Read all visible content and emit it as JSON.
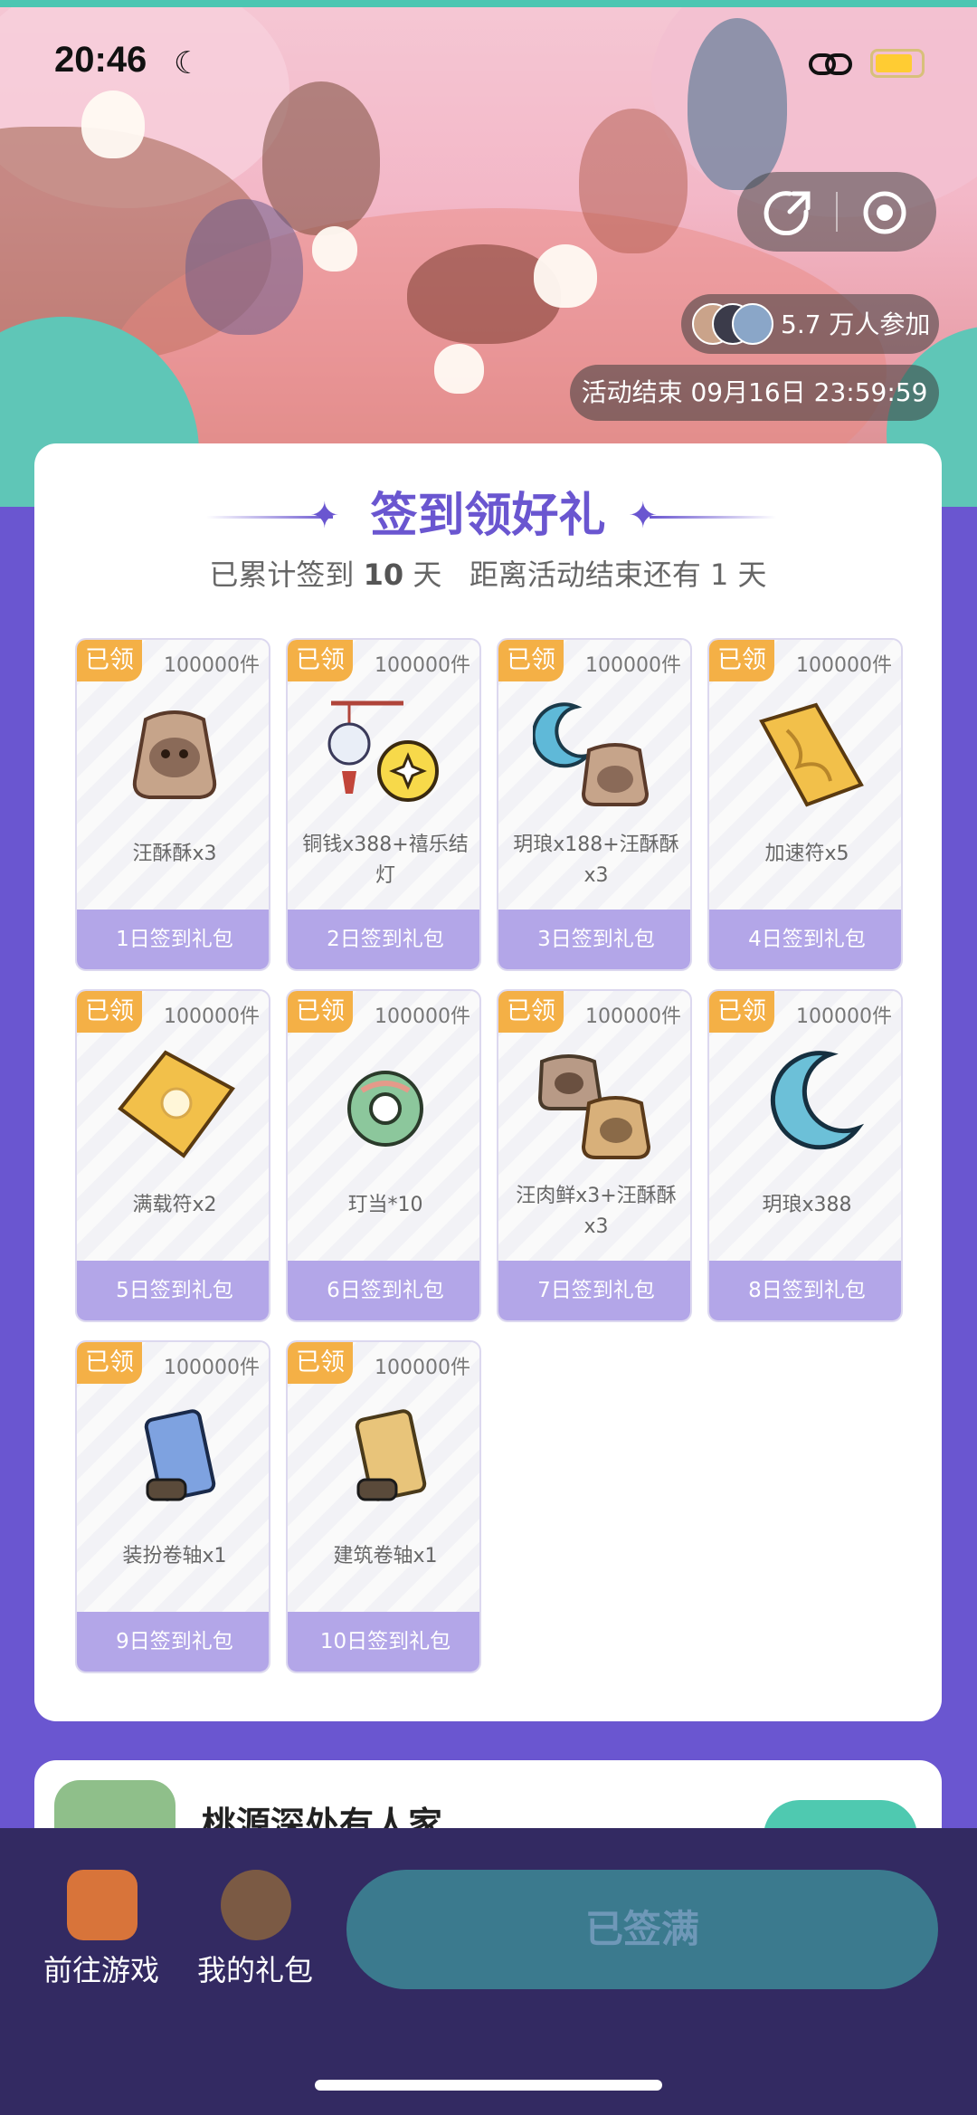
{
  "status_bar": {
    "time": "20:46"
  },
  "banner": {
    "participants": "5.7 万人参加",
    "end_time": "活动结束 09月16日 23:59:59"
  },
  "checkin": {
    "title": "签到领好礼",
    "subtitle_prefix": "已累计签到",
    "days_signed": "10",
    "subtitle_days_unit": "天",
    "subtitle_suffix": "距离活动结束还有 1 天"
  },
  "rewards": [
    {
      "badge": "已领",
      "quantity": "100000件",
      "name": "汪酥酥x3",
      "label": "1日签到礼包",
      "icon": "bag-icon"
    },
    {
      "badge": "已领",
      "quantity": "100000件",
      "name": "铜钱x388+禧乐结灯",
      "label": "2日签到礼包",
      "icon": "lantern-coin-icon"
    },
    {
      "badge": "已领",
      "quantity": "100000件",
      "name": "玥琅x188+汪酥酥x3",
      "label": "3日签到礼包",
      "icon": "moon-bag-icon"
    },
    {
      "badge": "已领",
      "quantity": "100000件",
      "name": "加速符x5",
      "label": "4日签到礼包",
      "icon": "talisman-icon"
    },
    {
      "badge": "已领",
      "quantity": "100000件",
      "name": "满载符x2",
      "label": "5日签到礼包",
      "icon": "talisman-flower-icon"
    },
    {
      "badge": "已领",
      "quantity": "100000件",
      "name": "玎当*10",
      "label": "6日签到礼包",
      "icon": "ring-icon"
    },
    {
      "badge": "已领",
      "quantity": "100000件",
      "name": "汪肉鲜x3+汪酥酥x3",
      "label": "7日签到礼包",
      "icon": "double-bag-icon"
    },
    {
      "badge": "已领",
      "quantity": "100000件",
      "name": "玥琅x388",
      "label": "8日签到礼包",
      "icon": "moon-icon"
    },
    {
      "badge": "已领",
      "quantity": "100000件",
      "name": "装扮卷轴x1",
      "label": "9日签到礼包",
      "icon": "scroll-blue-icon"
    },
    {
      "badge": "已领",
      "quantity": "100000件",
      "name": "建筑卷轴x1",
      "label": "10日签到礼包",
      "icon": "scroll-gold-icon"
    }
  ],
  "game": {
    "title": "桃源深处有人家"
  },
  "bottom_nav": {
    "game_label": "前往游戏",
    "gift_label": "我的礼包",
    "signed_button": "已签满"
  },
  "colors": {
    "accent": "#6a56d0",
    "badge": "#f4b046",
    "footer": "#b3a6e8",
    "bottom_bar": "#332a62"
  }
}
